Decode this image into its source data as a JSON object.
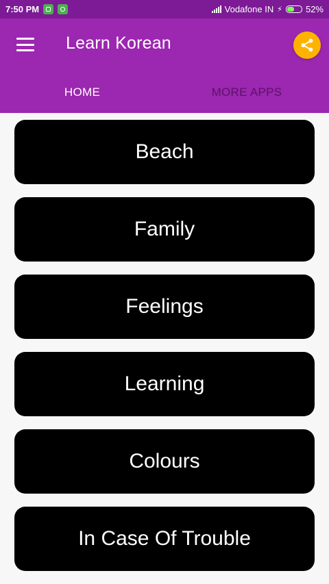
{
  "status_bar": {
    "time": "7:50 PM",
    "carrier": "Vodafone IN",
    "battery": "52%",
    "battery_level": 0.52
  },
  "app_bar": {
    "title": "Learn Korean",
    "menu_icon": "hamburger-menu-icon",
    "share_icon": "share-icon",
    "accent_color": "#9c27b0",
    "share_color": "#ffb300"
  },
  "tabs": [
    {
      "label": "HOME",
      "active": true
    },
    {
      "label": "MORE APPS",
      "active": false
    }
  ],
  "categories": [
    {
      "label": "Beach"
    },
    {
      "label": "Family"
    },
    {
      "label": "Feelings"
    },
    {
      "label": "Learning"
    },
    {
      "label": "Colours"
    },
    {
      "label": "In Case Of Trouble"
    }
  ]
}
